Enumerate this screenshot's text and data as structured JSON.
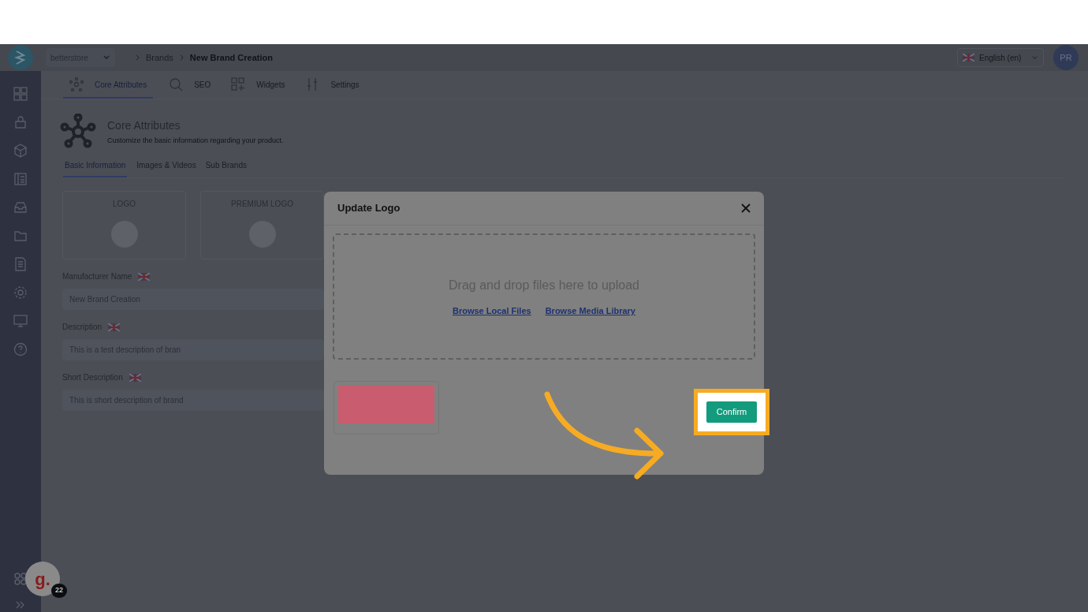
{
  "top_bar": {
    "store_selector": "betterstore",
    "breadcrumbs": [
      "Brands",
      "New Brand Creation"
    ],
    "language": "English (en)",
    "avatar": "PR"
  },
  "sidebar": {
    "helper_logo": "g.",
    "helper_count": "22"
  },
  "tabs": [
    {
      "label": "Core Attributes",
      "selected": true
    },
    {
      "label": "SEO",
      "selected": false
    },
    {
      "label": "Widgets",
      "selected": false
    },
    {
      "label": "Settings",
      "selected": false
    }
  ],
  "section": {
    "title": "Core Attributes",
    "subtitle": "Customize the basic information regarding your product."
  },
  "sub_tabs": [
    {
      "label": "Basic Information",
      "selected": true
    },
    {
      "label": "Images & Videos",
      "selected": false
    },
    {
      "label": "Sub Brands",
      "selected": false
    }
  ],
  "logo_cards": [
    "LOGO",
    "PREMIUM LOGO"
  ],
  "fields": [
    {
      "label": "Manufacturer Name",
      "value": "New Brand Creation"
    },
    {
      "label": "Description",
      "value": "This is a test description of bran"
    },
    {
      "label": "Short Description",
      "value": "This is short description of brand"
    }
  ],
  "modal": {
    "title": "Update Logo",
    "dropzone_text": "Drag and drop files here to upload",
    "links": [
      "Browse Local Files",
      "Browse Media Library"
    ],
    "confirm": "Confirm"
  }
}
